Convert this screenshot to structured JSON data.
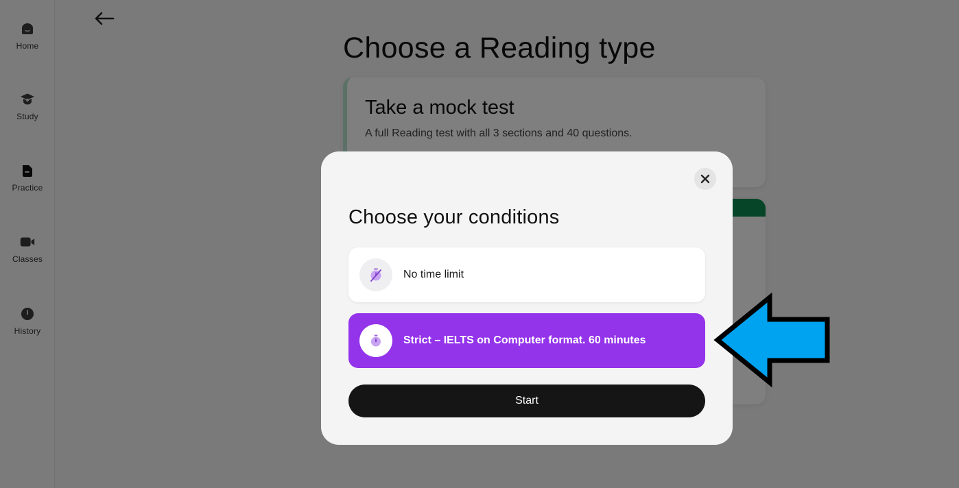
{
  "sidebar": {
    "items": [
      {
        "label": "Home",
        "icon": "home-icon"
      },
      {
        "label": "Study",
        "icon": "graduation-cap-icon"
      },
      {
        "label": "Practice",
        "icon": "document-icon"
      },
      {
        "label": "Classes",
        "icon": "video-camera-icon"
      },
      {
        "label": "History",
        "icon": "clock-icon"
      }
    ]
  },
  "main": {
    "back_icon": "arrow-left-icon",
    "title": "Choose a Reading type",
    "mock_card": {
      "title": "Take a mock test",
      "description": "A full Reading test with all 3 sections and 40 questions."
    }
  },
  "modal": {
    "title": "Choose your conditions",
    "close_icon": "close-icon",
    "options": [
      {
        "label": "No time limit",
        "icon": "no-timer-icon",
        "selected": false
      },
      {
        "label": "Strict – IELTS on Computer format. 60 minutes",
        "icon": "stopwatch-icon",
        "selected": true
      }
    ],
    "start_label": "Start"
  },
  "colors": {
    "accent_purple": "#9333ea",
    "annotation_arrow": "#00a3ef",
    "green_band": "#0d8a4e",
    "start_button": "#151515"
  }
}
